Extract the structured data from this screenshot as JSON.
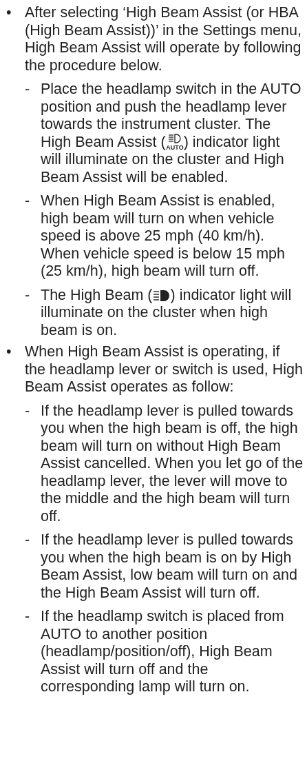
{
  "bullets": [
    {
      "marker": "•",
      "segments": [
        {
          "kind": "text",
          "text": "After selecting ‘High Beam Assist (or HBA (High Beam Assist))’ in the Settings menu, High Beam Assist will operate by following the procedure below."
        }
      ],
      "steps": [
        {
          "marker": "-",
          "segments": [
            {
              "kind": "text",
              "text": "Place the headlamp switch in the AUTO position and push the headlamp lever towards the instrument cluster. The High Beam Assist ("
            },
            {
              "kind": "auto_beam_icon",
              "label": "AUTO"
            },
            {
              "kind": "text",
              "text": ") indicator light will illuminate on the cluster and High Beam Assist will be enabled."
            }
          ]
        },
        {
          "marker": "-",
          "segments": [
            {
              "kind": "text",
              "text": "When High Beam Assist is enabled, high beam will turn on when vehicle speed is above 25 mph (40 km/h). When vehicle speed is below 15 mph (25 km/h), high beam will turn off."
            }
          ]
        },
        {
          "marker": "-",
          "segments": [
            {
              "kind": "text",
              "text": "The High Beam ("
            },
            {
              "kind": "high_beam_icon"
            },
            {
              "kind": "text",
              "text": ") indicator light will illuminate on the cluster when high beam is on."
            }
          ]
        }
      ]
    },
    {
      "marker": "•",
      "segments": [
        {
          "kind": "text",
          "text": "When High Beam Assist is operating, if the headlamp lever or switch is used, High Beam Assist operates as follow:"
        }
      ],
      "steps": [
        {
          "marker": "-",
          "segments": [
            {
              "kind": "text",
              "text": "If the headlamp lever is pulled towards you when the high beam is off, the high beam will turn on without High Beam Assist cancelled. When you let go of the headlamp lever, the lever will move to the middle and the high beam will turn off."
            }
          ]
        },
        {
          "marker": "-",
          "segments": [
            {
              "kind": "text",
              "text": "If the headlamp lever is pulled towards you when the high beam is on by High Beam Assist, low beam will turn on and the High Beam Assist will turn off."
            }
          ]
        },
        {
          "marker": "-",
          "segments": [
            {
              "kind": "text",
              "text": "If the headlamp switch is placed from AUTO to another position (headlamp/position/off), High Beam Assist will turn off and the corresponding lamp will turn on."
            }
          ]
        }
      ]
    }
  ]
}
